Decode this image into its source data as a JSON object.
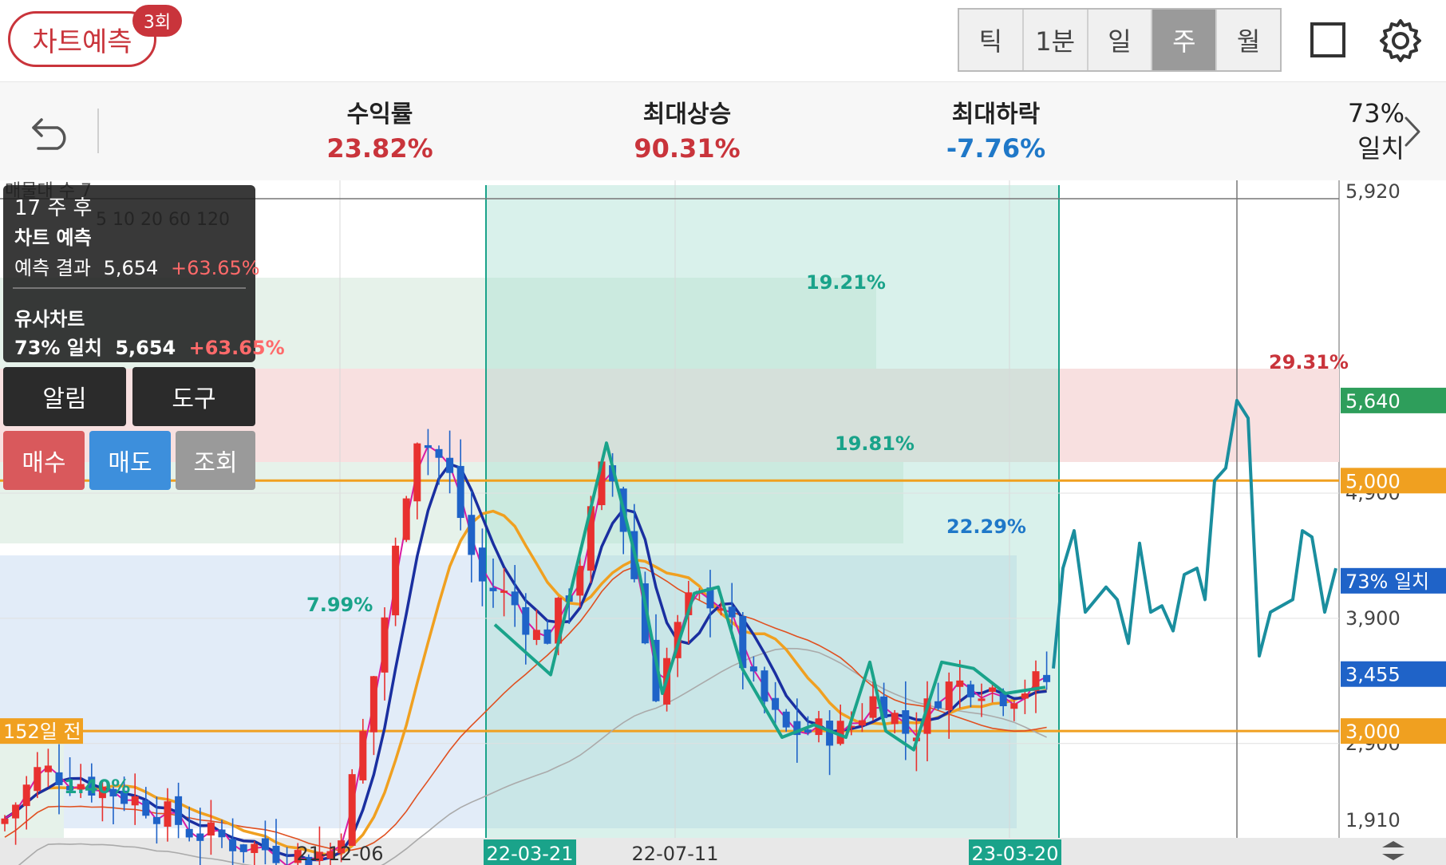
{
  "header": {
    "predict_button": "차트예측",
    "predict_count": "3회",
    "periods": [
      "틱",
      "1분",
      "일",
      "주",
      "월"
    ],
    "active_period": "주"
  },
  "stats": {
    "return_label": "수익률",
    "return_value": "23.82%",
    "max_rise_label": "최대상승",
    "max_rise_value": "90.31%",
    "max_fall_label": "최대하락",
    "max_fall_value": "-7.76%",
    "match_pct": "73%",
    "match_label": "일치"
  },
  "overlay": {
    "weeks_after": "17 주 후",
    "section1_title": "차트 예측",
    "result_label": "예측 결과",
    "result_price": "5,654",
    "result_change": "+63.65%",
    "section2_title": "유사차트",
    "similar_match": "73% 일치",
    "similar_price": "5,654",
    "similar_change": "+63.65%",
    "behind_text": "매물대 수 7",
    "ma_legend": "5 10 20 60 120"
  },
  "actions": {
    "alert": "알림",
    "tools": "도구",
    "buy": "매수",
    "sell": "매도",
    "inquiry": "조회"
  },
  "chart_data": {
    "type": "candlestick",
    "y_ticks": [
      "5,920",
      "4,900",
      "3,900",
      "2,900",
      "1,910"
    ],
    "x_ticks": [
      "21-12-06",
      "22-03-21",
      "22-07-11",
      "23-03-20"
    ],
    "price_tags": [
      {
        "label": "5,640",
        "color": "#2e9e5b"
      },
      {
        "label": "5,000",
        "color": "#f0a020"
      },
      {
        "label": "73% 일치",
        "color": "#1f63c8"
      },
      {
        "label": "3,455",
        "color": "#1f63c8"
      },
      {
        "label": "3,000",
        "color": "#f0a020"
      }
    ],
    "horizontal_levels": [
      5000,
      3000
    ],
    "left_level_label": "152일 전",
    "region_pcts": [
      "1.40%",
      "7.99%",
      "19.21%",
      "19.81%",
      "22.29%",
      "29.31%"
    ],
    "ma_periods": [
      5,
      10,
      20,
      60,
      120
    ],
    "colors": {
      "up": "#e8312f",
      "down": "#1f63c8",
      "ma5": "#d81ba3",
      "ma10": "#1a2fa0",
      "ma20": "#f0a020",
      "ma60": "#e05020",
      "ma120": "#aaaaaa",
      "pattern": "#1aa38a",
      "prediction": "#1a8e9e",
      "level": "#f0a020"
    }
  }
}
